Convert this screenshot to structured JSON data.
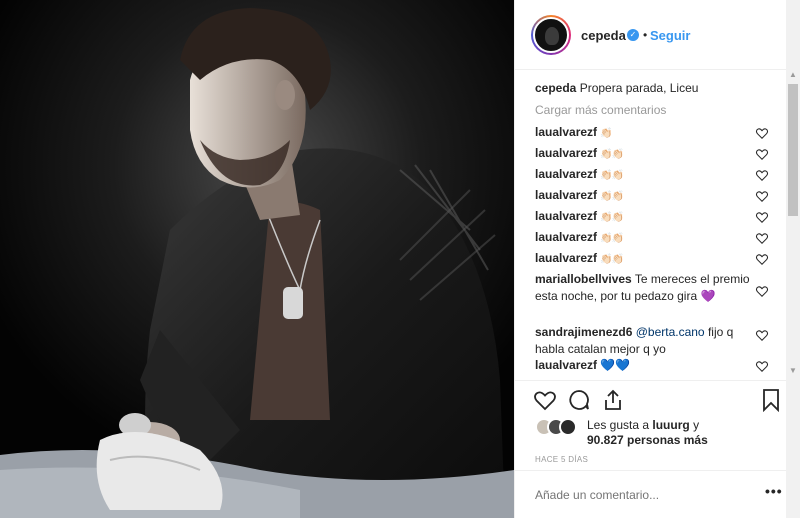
{
  "post": {
    "photo_subject": "concert-photo"
  },
  "header": {
    "username": "cepeda",
    "dot": "•",
    "follow_label": "Seguir"
  },
  "caption": {
    "username": "cepeda",
    "text": "Propera parada, Liceu"
  },
  "load_more": "Cargar más comentarios",
  "comments": [
    {
      "user": "laualvarezf",
      "text": "👏🏻"
    },
    {
      "user": "laualvarezf",
      "text": "👏🏻👏🏻"
    },
    {
      "user": "laualvarezf",
      "text": "👏🏻👏🏻"
    },
    {
      "user": "laualvarezf",
      "text": "👏🏻👏🏻"
    },
    {
      "user": "laualvarezf",
      "text": "👏🏻👏🏻"
    },
    {
      "user": "laualvarezf",
      "text": "👏🏻👏🏻"
    },
    {
      "user": "laualvarezf",
      "text": "👏🏻👏🏻"
    },
    {
      "user": "mariallobellvives",
      "text": "Te mereces el premio esta noche, por tu pedazo gira",
      "emoji": "💜"
    },
    {
      "user": "sandrajimenezd6",
      "mention": "@berta.cano",
      "text": "fijo q habla catalan mejor q yo"
    },
    {
      "user": "laualvarezf",
      "text": "💙💙"
    }
  ],
  "likes": {
    "prefix": "Les gusta a",
    "user": "luuurg",
    "suffix": "y",
    "count": "90.827 personas más"
  },
  "time_ago": "HACE 5 DÍAS",
  "add_comment_placeholder": "Añade un comentario...",
  "more_label": "•••",
  "colors": {
    "accent": "#3897f0",
    "text": "#262626",
    "muted": "#999999",
    "border": "#efefef"
  }
}
